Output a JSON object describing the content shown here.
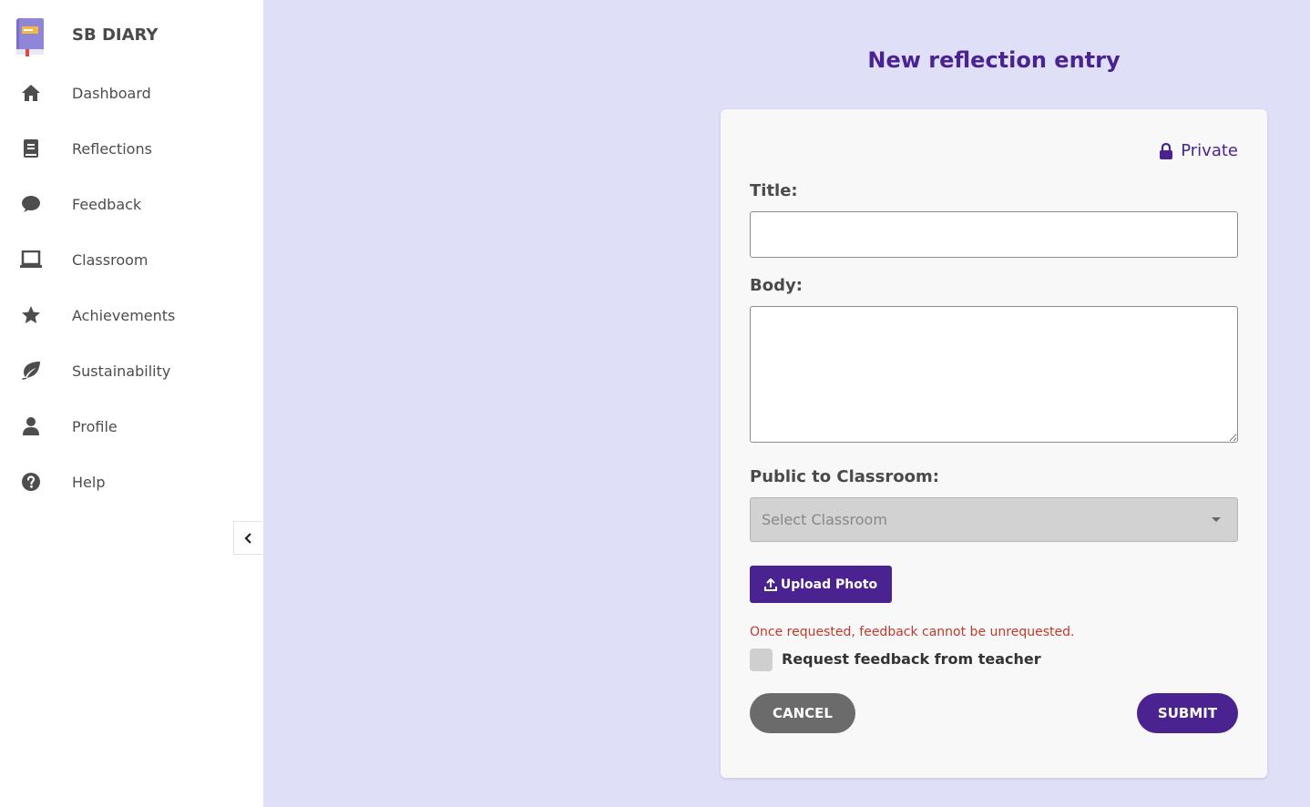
{
  "app": {
    "name": "SB DIARY"
  },
  "sidebar": {
    "items": [
      {
        "label": "Dashboard",
        "icon": "home-icon"
      },
      {
        "label": "Reflections",
        "icon": "book-icon"
      },
      {
        "label": "Feedback",
        "icon": "comment-icon"
      },
      {
        "label": "Classroom",
        "icon": "laptop-icon"
      },
      {
        "label": "Achievements",
        "icon": "star-icon"
      },
      {
        "label": "Sustainability",
        "icon": "leaf-icon"
      },
      {
        "label": "Profile",
        "icon": "user-icon"
      },
      {
        "label": "Help",
        "icon": "question-circle-icon"
      }
    ],
    "collapse_icon": "chevron-left-icon"
  },
  "page": {
    "title": "New reflection entry"
  },
  "form": {
    "privacy_label": "Private",
    "title_label": "Title:",
    "title_value": "",
    "body_label": "Body:",
    "body_value": "",
    "classroom_label": "Public to Classroom:",
    "classroom_placeholder": "Select Classroom",
    "upload_label": "Upload Photo",
    "warning_text": "Once requested, feedback cannot be unrequested.",
    "request_feedback_label": "Request feedback from teacher",
    "request_feedback_checked": false,
    "cancel_label": "CANCEL",
    "submit_label": "SUBMIT"
  },
  "colors": {
    "accent": "#4b2391",
    "background": "#dfe0f7",
    "warning": "#c0392b",
    "cancel": "#6b6b6b"
  }
}
